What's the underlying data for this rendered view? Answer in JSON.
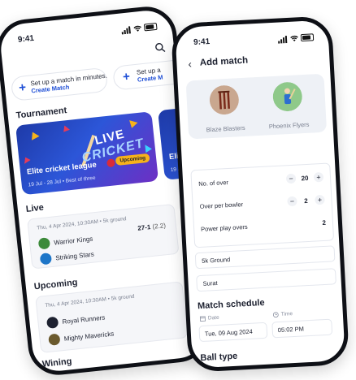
{
  "home": {
    "status_time": "9:41",
    "promos": [
      {
        "line1": "Set up a match in minutes.",
        "link": "Create Match"
      },
      {
        "line1": "Set up a",
        "link": "Create M"
      }
    ],
    "tournament_title": "Tournament",
    "banners": [
      {
        "art_line1": "LIVE",
        "art_line2": "CRICKET",
        "event": "Elite cricket league",
        "dates": "19 Jul - 28 Jul",
        "format": "Best of three",
        "badge": "Upcoming"
      },
      {
        "event": "Eli",
        "dates": "19 J"
      }
    ],
    "live_title": "Live",
    "live_card": {
      "info": "Thu, 4 Apr 2024, 10:30AM • 5k ground",
      "team1": "Warrior Kings",
      "team2": "Striking Stars",
      "score": "27-1",
      "overs": "(2.2)"
    },
    "upcoming_title": "Upcoming",
    "upcoming_card": {
      "info": "Thu, 4 Apr 2024, 10:30AM • 5k ground",
      "team1": "Royal Runners",
      "team2": "Mighty Mavericks"
    },
    "winning_title": "Wining"
  },
  "add_match": {
    "status_time": "9:41",
    "title": "Add match",
    "team_a": "Blaze Blasters",
    "team_b": "Phoenix Flyers",
    "rows": [
      {
        "label": "No. of over",
        "value": "20"
      },
      {
        "label": "Over per bowler",
        "value": "2"
      },
      {
        "label": "Power play overs",
        "value": "2"
      }
    ],
    "ground": "5k Ground",
    "city": "Surat",
    "schedule_title": "Match schedule",
    "date_label": "Date",
    "date_value": "Tue, 09 Aug 2024",
    "time_label": "Time",
    "time_value": "05:02 PM",
    "ball_type_title": "Ball type"
  },
  "colors": {
    "accent": "#1f4fd6",
    "badge": "#f6b21b",
    "frame": "#0e1016"
  }
}
